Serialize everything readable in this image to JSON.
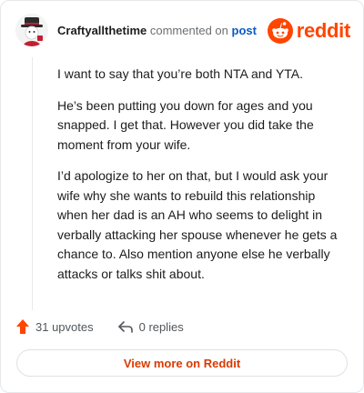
{
  "comment": {
    "username": "Craftyallthetime",
    "commented_text": "commented on",
    "post_link_text": "post",
    "paragraphs": [
      "I want to say that you’re both NTA and YTA.",
      "He’s been putting you down for ages and you snapped. I get that. However you did take the moment from your wife.",
      "I’d apologize to her on that, but I would ask your wife why she wants to rebuild this relationship when her dad is an AH who seems to delight in verbally attacking her spouse whenever he gets a chance to. Also mention anyone else he verbally attacks or talks shit about."
    ]
  },
  "brand": {
    "name": "reddit",
    "color": "#ff4500"
  },
  "actions": {
    "upvotes": "31 upvotes",
    "replies": "0 replies",
    "upvote_icon": "upvote-arrow-icon",
    "reply_icon": "reply-arrow-icon"
  },
  "footer": {
    "view_more_label": "View more on Reddit",
    "accent": "#d93a00"
  }
}
